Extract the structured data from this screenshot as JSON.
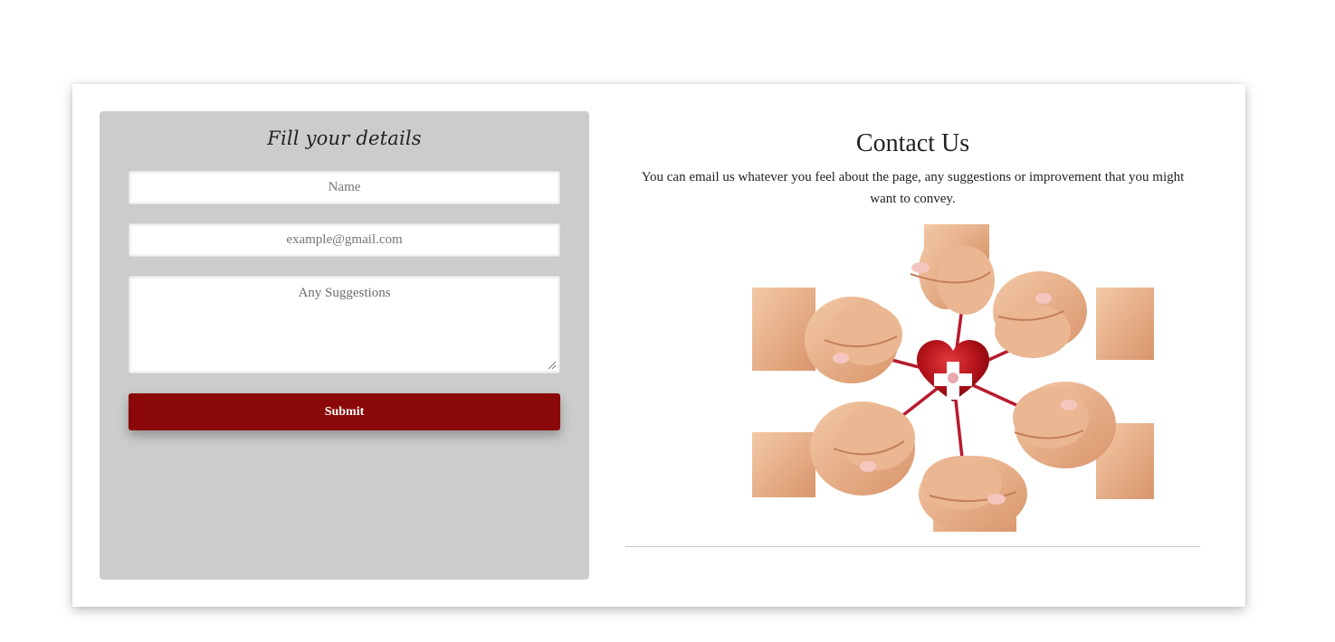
{
  "form": {
    "title": "Fill your details",
    "name_placeholder": "Name",
    "email_placeholder": "example@gmail.com",
    "suggestions_placeholder": "Any Suggestions",
    "submit_label": "Submit"
  },
  "contact": {
    "title": "Contact Us",
    "description": "You can email us whatever you feel about the page, any suggestions or improvement that you might want to convey.",
    "image": "six-fists-around-heart-with-red-cross-illustration"
  },
  "colors": {
    "accent": "#8b0808",
    "form_panel_bg": "#cccccc",
    "heart_red": "#c0121a"
  }
}
